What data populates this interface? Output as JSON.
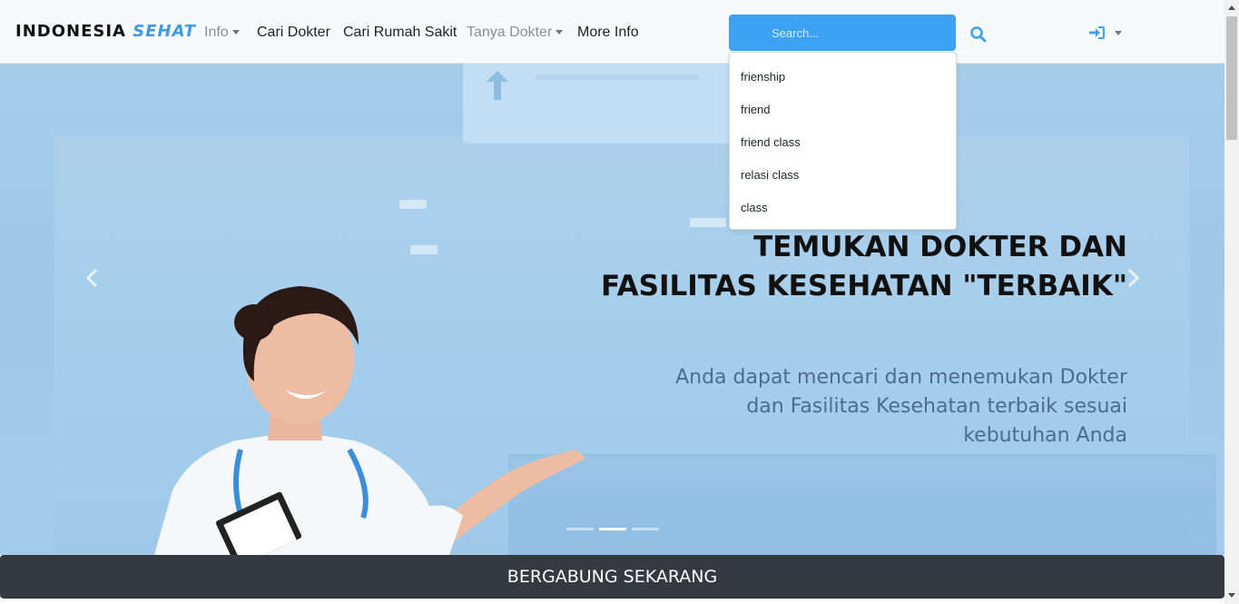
{
  "navbar": {
    "brand": {
      "part1": "INDONESIA",
      "part2": "SEHAT"
    },
    "links": [
      {
        "label": "Info",
        "dropdown": true
      },
      {
        "label": "Cari Dokter",
        "dropdown": false
      },
      {
        "label": "Cari Rumah Sakit",
        "dropdown": false
      },
      {
        "label": "Tanya Dokter",
        "dropdown": true
      },
      {
        "label": "More Info",
        "dropdown": false
      }
    ],
    "search": {
      "placeholder": "Search...",
      "value": ""
    }
  },
  "suggestions": [
    "frienship",
    "friend",
    "friend class",
    "relasi class",
    "class"
  ],
  "hero": {
    "title": "TEMUKAN DOKTER DAN\nFASILITAS KESEHATAN \"TERBAIK\"",
    "subtitle": "Anda dapat mencari dan menemukan Dokter\ndan Fasilitas Kesehatan terbaik sesuai \nkebutuhan Anda",
    "slides_total": 3,
    "active_slide": 2
  },
  "cta": {
    "label": "BERGABUNG SEKARANG"
  },
  "colors": {
    "accent": "#3ea2f2",
    "dark_bar": "#343a40"
  },
  "icons": {
    "search": "search-icon",
    "login": "sign-in-icon",
    "prev": "chevron-left-icon",
    "next": "chevron-right-icon"
  }
}
